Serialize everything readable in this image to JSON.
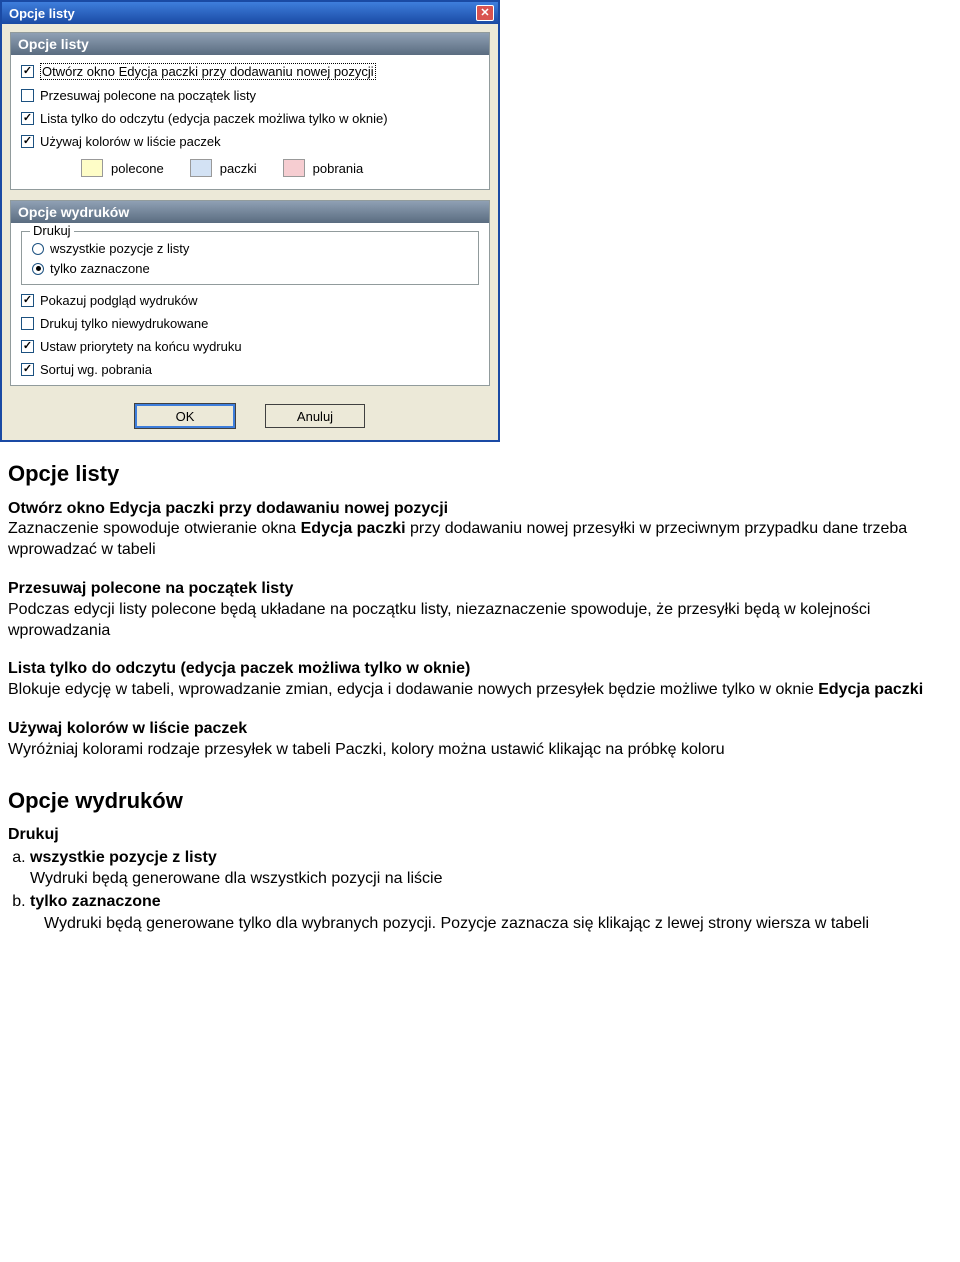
{
  "dialog": {
    "title": "Opcje listy",
    "panel1": {
      "header": "Opcje listy",
      "checks": [
        {
          "label": "Otwórz okno Edycja paczki przy dodawaniu nowej pozycji",
          "checked": true,
          "focused": true
        },
        {
          "label": "Przesuwaj polecone na początek listy",
          "checked": false
        },
        {
          "label": "Lista tylko do odczytu (edycja paczek możliwa tylko w oknie)",
          "checked": true
        },
        {
          "label": "Używaj kolorów w liście paczek",
          "checked": true
        }
      ],
      "legend": [
        {
          "label": "polecone",
          "color": "#fefdc7"
        },
        {
          "label": "paczki",
          "color": "#d3e2f4"
        },
        {
          "label": "pobrania",
          "color": "#f6cdd1"
        }
      ]
    },
    "panel2": {
      "header": "Opcje wydruków",
      "fieldset_legend": "Drukuj",
      "radios": [
        {
          "label": "wszystkie pozycje z listy",
          "selected": false
        },
        {
          "label": "tylko zaznaczone",
          "selected": true
        }
      ],
      "checks": [
        {
          "label": "Pokazuj podgląd wydruków",
          "checked": true
        },
        {
          "label": "Drukuj tylko niewydrukowane",
          "checked": false
        },
        {
          "label": "Ustaw priorytety na końcu wydruku",
          "checked": true
        },
        {
          "label": "Sortuj wg. pobrania",
          "checked": true
        }
      ]
    },
    "buttons": {
      "ok": "OK",
      "cancel": "Anuluj"
    }
  },
  "doc": {
    "h1": "Opcje listy",
    "blocks": [
      {
        "title": "Otwórz okno Edycja paczki przy dodawaniu nowej pozycji",
        "body_pre": "Zaznaczenie spowoduje otwieranie okna ",
        "body_bold": "Edycja paczki",
        "body_post": " przy dodawaniu nowej przesyłki w przeciwnym przypadku dane trzeba wprowadzać w tabeli"
      },
      {
        "title": "Przesuwaj polecone na początek listy",
        "body": "Podczas edycji listy polecone będą układane na początku listy, niezaznaczenie spowoduje, że przesyłki będą w kolejności wprowadzania"
      },
      {
        "title": "Lista tylko do odczytu (edycja paczek możliwa tylko w oknie)",
        "body_pre": "Blokuje edycję w tabeli, wprowadzanie zmian, edycja i dodawanie nowych przesyłek będzie możliwe tylko w oknie ",
        "body_bold": "Edycja paczki",
        "body_post": ""
      },
      {
        "title": "Używaj kolorów w liście paczek",
        "body": "Wyróżniaj kolorami rodzaje przesyłek w tabeli Paczki, kolory można ustawić klikając na próbkę koloru"
      }
    ],
    "h2": "Opcje wydruków",
    "drukuj_label": "Drukuj",
    "ol": [
      {
        "title": "wszystkie pozycje z listy",
        "body": "Wydruki będą generowane dla wszystkich pozycji na liście"
      },
      {
        "title": "tylko zaznaczone",
        "body": "Wydruki będą generowane tylko dla wybranych pozycji. Pozycje zaznacza się klikając z lewej strony wiersza w tabeli"
      }
    ]
  }
}
